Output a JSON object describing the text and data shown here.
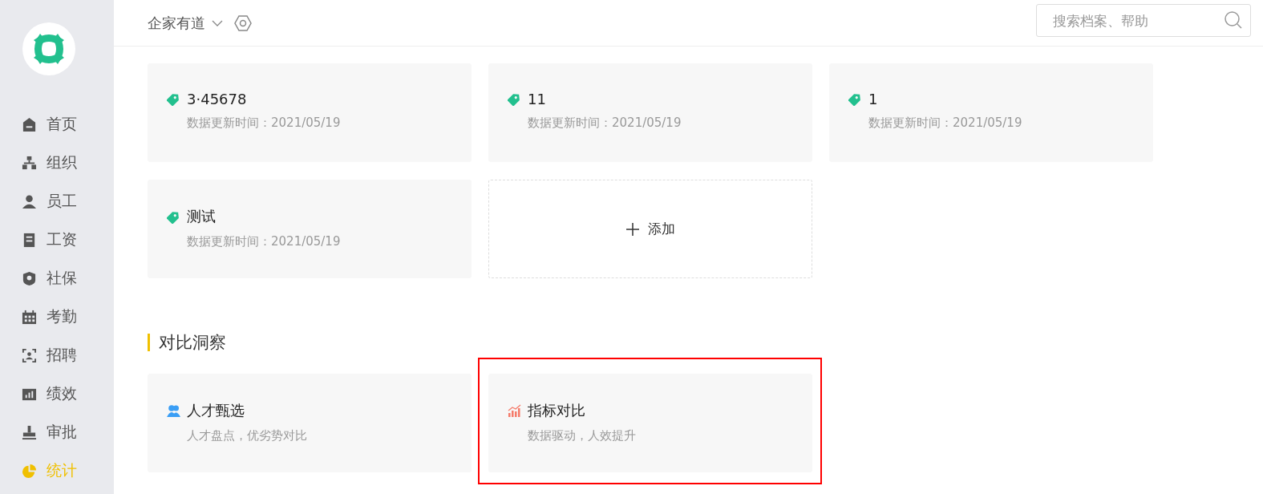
{
  "sidebar": {
    "items": [
      {
        "label": "首页",
        "selected": false
      },
      {
        "label": "组织",
        "selected": false
      },
      {
        "label": "员工",
        "selected": false
      },
      {
        "label": "工资",
        "selected": false
      },
      {
        "label": "社保",
        "selected": false
      },
      {
        "label": "考勤",
        "selected": false
      },
      {
        "label": "招聘",
        "selected": false
      },
      {
        "label": "绩效",
        "selected": false
      },
      {
        "label": "审批",
        "selected": false
      },
      {
        "label": "统计",
        "selected": true
      }
    ]
  },
  "header": {
    "company": "企家有道",
    "search": {
      "placeholder": "搜索档案、帮助"
    }
  },
  "metric_cards": [
    {
      "title": "3·45678",
      "subtitle": "数据更新时间：2021/05/19"
    },
    {
      "title": "11",
      "subtitle": "数据更新时间：2021/05/19"
    },
    {
      "title": "1",
      "subtitle": "数据更新时间：2021/05/19"
    },
    {
      "title": "测试",
      "subtitle": "数据更新时间：2021/05/19"
    }
  ],
  "add_card": {
    "label": "添加"
  },
  "section": {
    "title": "对比洞察"
  },
  "insight_cards": [
    {
      "title": "人才甄选",
      "subtitle": "人才盘点，优劣势对比",
      "highlighted": false
    },
    {
      "title": "指标对比",
      "subtitle": "数据驱动，人效提升",
      "highlighted": true
    }
  ]
}
